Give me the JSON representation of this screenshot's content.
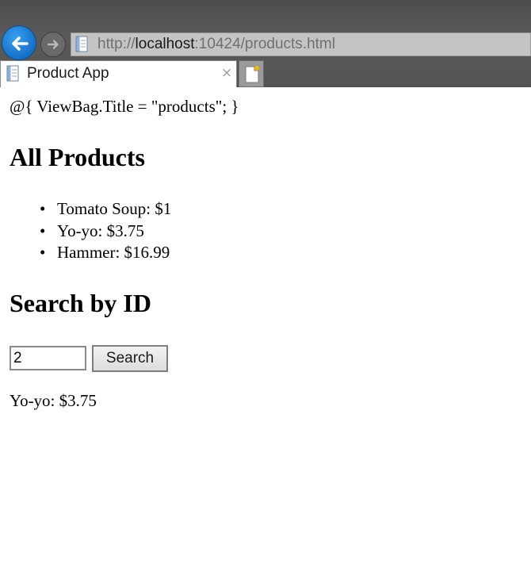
{
  "browser": {
    "url_scheme": "http://",
    "url_host": "localhost",
    "url_rest": ":10424/products.html",
    "tab_title": "Product App",
    "tab_close_glyph": "×",
    "icons": [
      "back-arrow-icon",
      "forward-arrow-icon",
      "page-icon",
      "new-tab-icon"
    ],
    "accent_color": "#1470c8"
  },
  "page": {
    "razor_line": "@{ ViewBag.Title = \"products\"; }",
    "all_products_heading": "All Products",
    "products": [
      {
        "bullet": "•",
        "text": "Tomato Soup: $1"
      },
      {
        "bullet": "•",
        "text": "Yo-yo: $3.75"
      },
      {
        "bullet": "•",
        "text": "Hammer: $16.99"
      }
    ],
    "search_heading": "Search by ID",
    "search_input_value": "2",
    "search_button_label": "Search",
    "result": "Yo-yo: $3.75"
  }
}
